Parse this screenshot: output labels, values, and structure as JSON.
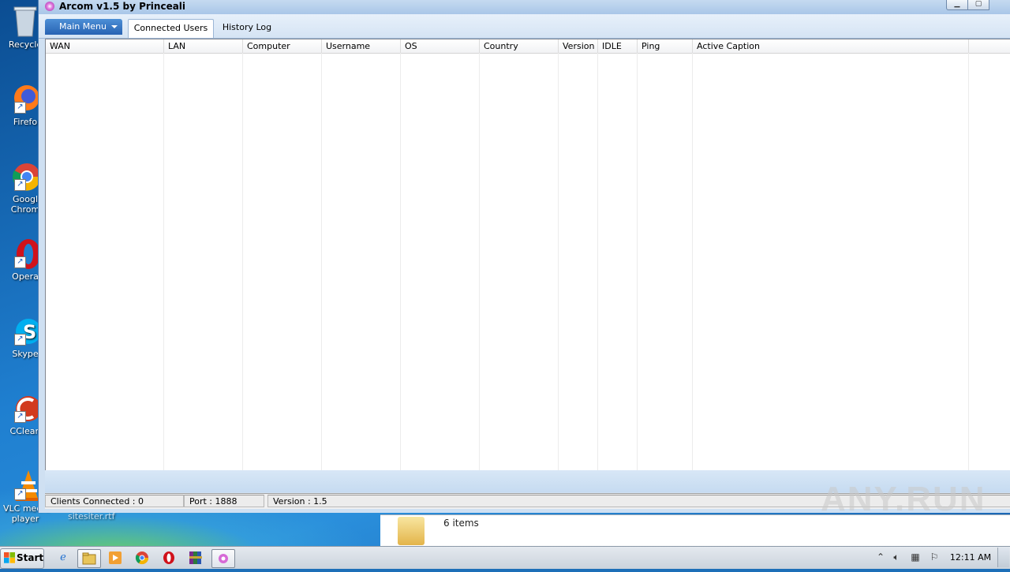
{
  "desktop": {
    "icons": [
      {
        "label": "Recycle",
        "name": "recycle-bin"
      },
      {
        "label": "Firefo",
        "name": "firefox"
      },
      {
        "label": "Googl",
        "label2": "Chrom",
        "name": "google-chrome"
      },
      {
        "label": "Opera",
        "name": "opera"
      },
      {
        "label": "Skype",
        "name": "skype"
      },
      {
        "label": "CClean",
        "name": "ccleaner"
      },
      {
        "label": "VLC media",
        "label2": "player",
        "name": "vlc-media-player"
      }
    ],
    "behind_label": "sitesiter.rtf"
  },
  "explorer": {
    "item_count": "6 items"
  },
  "window": {
    "title": "Arcom v1.5 by Princeali",
    "main_menu": "Main Menu",
    "tabs": [
      "Connected Users",
      "History Log"
    ],
    "active_tab": "Connected Users",
    "columns": [
      "WAN",
      "LAN",
      "Computer",
      "Username",
      "OS",
      "Country",
      "Version",
      "IDLE",
      "Ping",
      "Active Caption"
    ],
    "rows": [],
    "status": {
      "clients": "Clients Connected : 0",
      "port": "Port : 1888",
      "version": "Version : 1.5"
    }
  },
  "taskbar": {
    "start_label": "Start",
    "clock": "12:11 AM",
    "items": [
      "internet-explorer",
      "file-explorer",
      "media-player",
      "chrome",
      "opera",
      "winrar",
      "arcom"
    ]
  },
  "watermark": "ANY.RUN",
  "colors": {
    "accent": "#2763b3",
    "titlebar": "#a9c6e8",
    "desktop": "#1f7fd0"
  }
}
